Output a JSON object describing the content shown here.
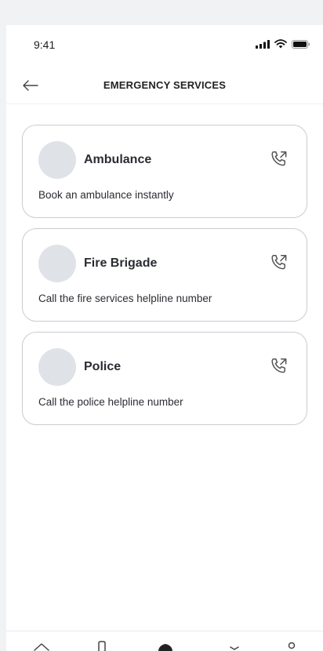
{
  "status_bar": {
    "time": "9:41"
  },
  "header": {
    "title": "EMERGENCY SERVICES"
  },
  "services": [
    {
      "title": "Ambulance",
      "description": "Book an ambulance instantly"
    },
    {
      "title": "Fire Brigade",
      "description": "Call the fire services helpline number"
    },
    {
      "title": "Police",
      "description": "Call the police helpline number"
    }
  ],
  "icons": {
    "back": "arrow-left-icon",
    "call": "phone-outgoing-icon",
    "nav": [
      "home-icon",
      "bookmark-icon",
      "shield-icon",
      "chevron-icon",
      "profile-icon"
    ]
  },
  "colors": {
    "card_border": "#c9ccd1",
    "avatar": "#dfe2e7",
    "text": "#2a2c33",
    "background": "#f1f2f4"
  }
}
